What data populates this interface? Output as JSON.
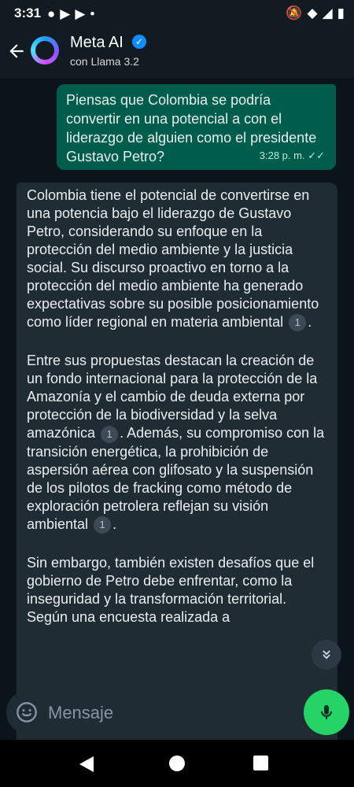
{
  "status_bar": {
    "time": "3:31"
  },
  "header": {
    "title": "Meta AI",
    "subtitle": "con Llama 3.2"
  },
  "messages": {
    "outgoing": {
      "text": "Piensas que Colombia se podría convertir en una potencial a con el liderazgo de alguien como el presidente Gustavo Petro?",
      "time": "3:28 p. m."
    },
    "incoming": {
      "p1": "Colombia tiene el potencial de convertirse en una potencia bajo el liderazgo de Gustavo Petro, considerando su enfoque en la protección del medio ambiente y la justicia social. Su discurso proactivo en torno a la protección del medio ambiente ha generado expectativas sobre su posible posicionamiento como líder regional en materia ambiental",
      "p2a": "Entre sus propuestas destacan la creación de un fondo internacional para la protección de la Amazonía y el cambio de deuda externa por protección de la biodiversidad y la selva amazónica",
      "p2b": "Además, su compromiso con la transición energética, la prohibición de aspersión aérea con glifosato y la suspensión de los pilotos de fracking como método de exploración petrolera reflejan su visión ambiental",
      "p3": "Sin embargo, también existen desafíos que el gobierno de Petro debe enfrentar, como la inseguridad y la transformación territorial. Según una encuesta realizada a",
      "citation": "1"
    }
  },
  "composer": {
    "placeholder": "Mensaje"
  },
  "colors": {
    "background": "#0b141a",
    "outgoing_bubble": "#005c4b",
    "incoming_bubble": "#202c33",
    "accent_mic": "#25d366"
  }
}
